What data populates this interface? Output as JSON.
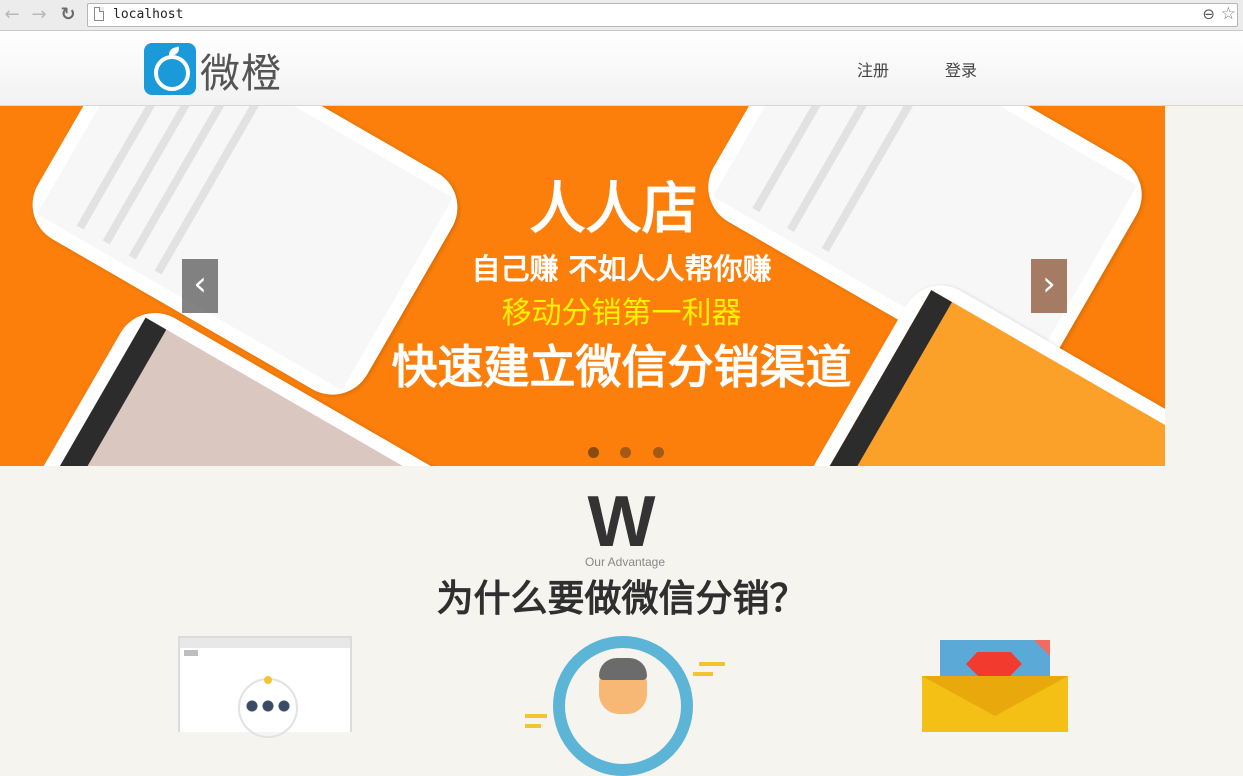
{
  "browser": {
    "url": "localhost",
    "icons": {
      "back": "arrow-left-icon",
      "forward": "arrow-right-icon",
      "reload": "reload-icon",
      "page": "document-icon",
      "zoom": "zoom-out-icon",
      "bookmark": "star-icon"
    }
  },
  "header": {
    "logo_text": "微橙",
    "nav": {
      "register": "注册",
      "login": "登录"
    }
  },
  "banner": {
    "headline": "人人店",
    "line1": "自己赚 不如人人帮你赚",
    "line2": "移动分销第一利器",
    "line3": "快速建立微信分销渠道",
    "prev_glyph": "‹",
    "next_glyph": "›",
    "slide_count": 3,
    "active_slide": 1,
    "colors": {
      "background": "#fb7f0a",
      "highlight": "#fff200"
    }
  },
  "advantage": {
    "big_letter": "W",
    "subtitle": "Our Advantage",
    "title": "为什么要做微信分销？",
    "illustrations": [
      "network-people-icon",
      "customer-cycle-icon",
      "superman-envelope-icon"
    ]
  }
}
